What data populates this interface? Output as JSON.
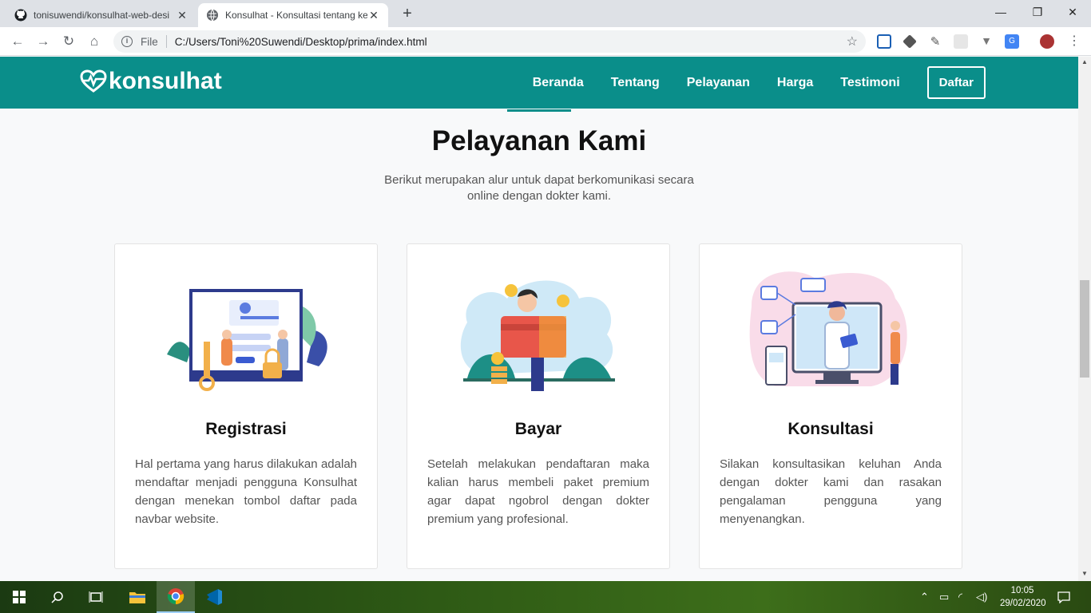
{
  "browser": {
    "tabs": [
      {
        "title": "tonisuwendi/konsulhat-web-desi",
        "close": "✕"
      },
      {
        "title": "Konsulhat - Konsultasi tentang ke",
        "close": "✕"
      }
    ],
    "new_tab": "+",
    "window_controls": {
      "minimize": "—",
      "restore": "❐",
      "close": "✕"
    },
    "address": {
      "scheme_label": "File",
      "url": "C:/Users/Toni%20Suwendi/Desktop/prima/index.html"
    }
  },
  "site": {
    "brand": "konsulhat",
    "nav": {
      "items": [
        "Beranda",
        "Tentang",
        "Pelayanan",
        "Harga",
        "Testimoni"
      ],
      "cta": "Daftar"
    },
    "section": {
      "title": "Pelayanan Kami",
      "subtitle": "Berikut merupakan alur untuk dapat berkomunikasi secara online dengan dokter kami."
    },
    "cards": [
      {
        "title": "Registrasi",
        "text": "Hal pertama yang harus dilakukan adalah mendaftar menjadi pengguna Konsulhat dengan menekan tombol daftar pada navbar website."
      },
      {
        "title": "Bayar",
        "text": "Setelah melakukan pendaftaran maka kalian harus membeli paket premium agar dapat ngobrol dengan dokter premium yang profesional."
      },
      {
        "title": "Konsultasi",
        "text": "Silakan konsultasikan keluhan Anda dengan dokter kami dan rasakan pengalaman pengguna yang menyenangkan."
      }
    ]
  },
  "taskbar": {
    "time": "10:05",
    "date": "29/02/2020"
  },
  "colors": {
    "brand": "#0a8e8a"
  }
}
